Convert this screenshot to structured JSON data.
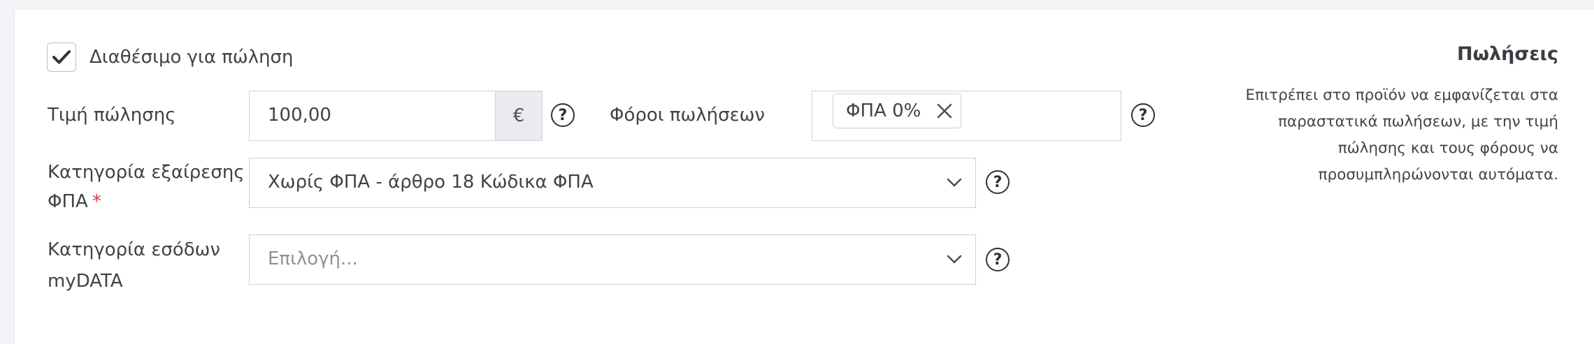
{
  "available_for_sale": {
    "label": "Διαθέσιμο για πώληση",
    "checked": true
  },
  "sale_price": {
    "label": "Τιμή πώλησης",
    "value": "100,00",
    "currency": "€"
  },
  "sales_taxes": {
    "label": "Φόροι πωλήσεων",
    "chip": "ΦΠΑ 0%"
  },
  "vat_exemption": {
    "label_line1": "Κατηγορία εξαίρεσης",
    "label_line2": "ΦΠΑ",
    "required_mark": "*",
    "value": "Χωρίς ΦΠΑ - άρθρο 18 Κώδικα ΦΠΑ"
  },
  "mydata_income": {
    "label_line1": "Κατηγορία εσόδων",
    "label_line2": "myDATA",
    "placeholder": "Επιλογή..."
  },
  "help_symbol": "?",
  "sidebar": {
    "title": "Πωλήσεις",
    "lines": [
      "Επιτρέπει στο προϊόν να εμφανίζεται στα",
      "παραστατικά πωλήσεων, με την τιμή",
      "πώλησης και τους φόρους να",
      "προσυμπληρώνονται αυτόματα."
    ]
  }
}
